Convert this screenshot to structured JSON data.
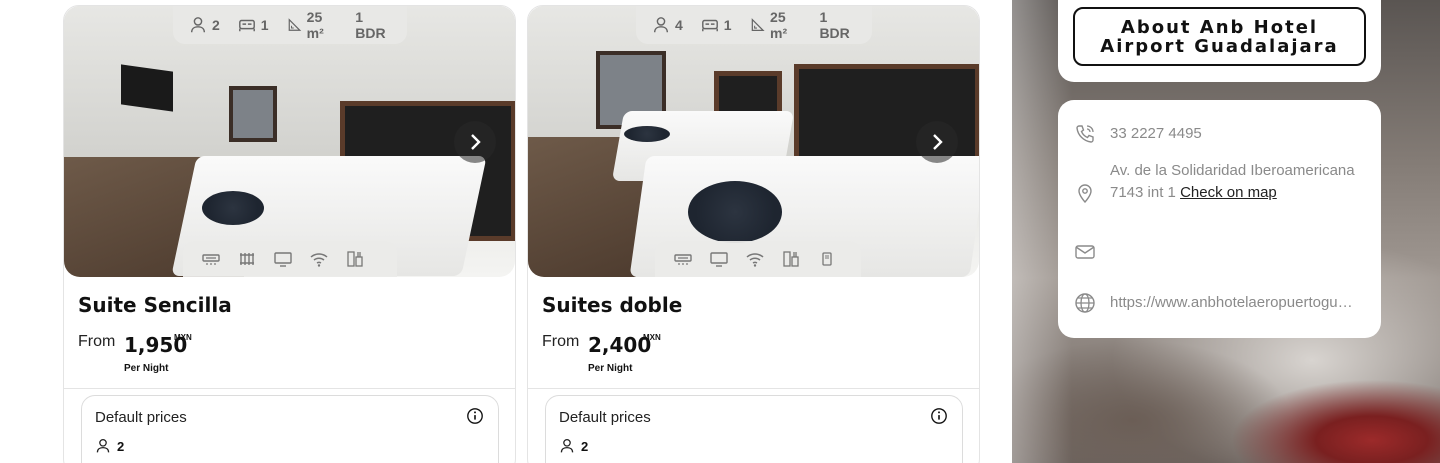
{
  "rooms": [
    {
      "name": "Suite Sencilla",
      "guests": "2",
      "beds": "1",
      "area": "25 m²",
      "bedrooms": "1 BDR",
      "price_from_label": "From",
      "price": "1,950",
      "currency": "MXN",
      "per_night": "Per Night",
      "price_box_title": "Default prices",
      "price_box_guests": "2",
      "amenities": [
        "air-conditioning-icon",
        "heater-icon",
        "tv-icon",
        "wifi-icon",
        "minibar-icon"
      ]
    },
    {
      "name": "Suites doble",
      "guests": "4",
      "beds": "1",
      "area": "25 m²",
      "bedrooms": "1 BDR",
      "price_from_label": "From",
      "price": "2,400",
      "currency": "MXN",
      "per_night": "Per Night",
      "price_box_title": "Default prices",
      "price_box_guests": "2",
      "amenities": [
        "air-conditioning-icon",
        "tv-icon",
        "wifi-icon",
        "minibar-icon",
        "hairdryer-icon"
      ]
    }
  ],
  "about": {
    "button_label": "About Anb Hotel Airport Guadalajara"
  },
  "contact": {
    "phone": "33 2227 4495",
    "address": "Av. de la Solidaridad Iberoamericana 7143 int 1",
    "map_link": "Check on map",
    "email": "",
    "website": "https://www.anbhotelaeropuertoguadalajara.com"
  },
  "colors": {
    "text_dark": "#111111",
    "text_muted": "#8a8a8a",
    "border": "#e4e4e4",
    "chip_bg": "#e8e8e6"
  }
}
